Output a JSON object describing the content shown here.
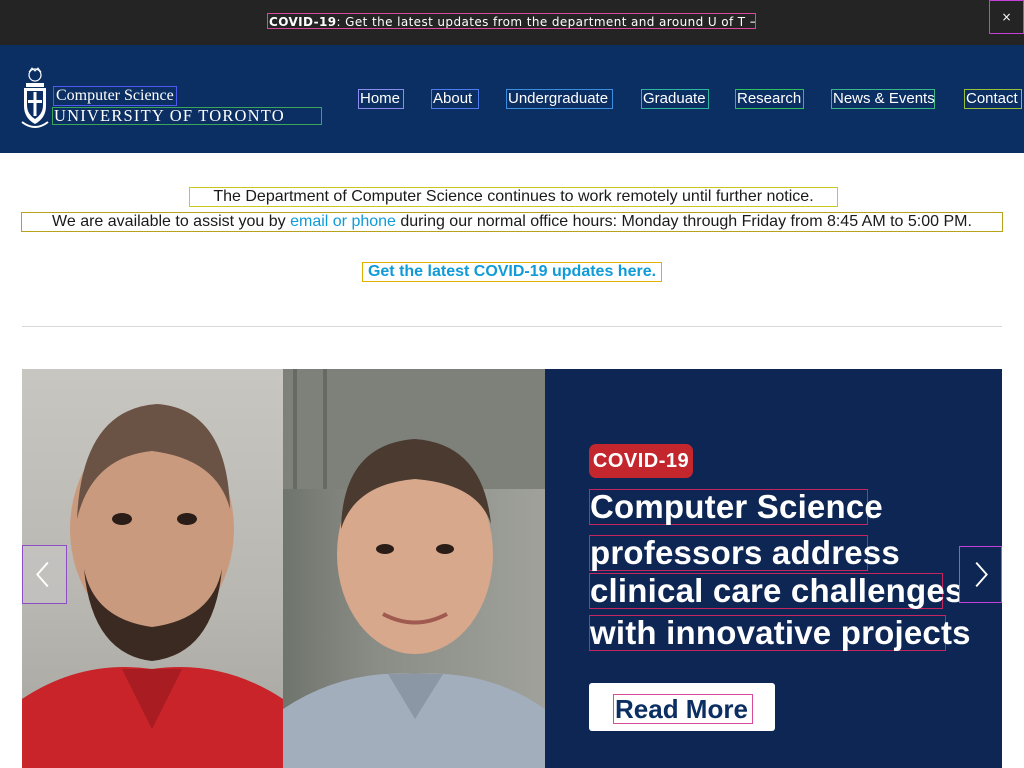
{
  "alert": {
    "label": "COVID-19",
    "text": ": Get the latest updates from the department and around U of T →",
    "close_label": "×"
  },
  "header": {
    "logo_department": "Computer Science",
    "logo_university": "UNIVERSITY OF TORONTO",
    "nav": [
      {
        "label": "Home"
      },
      {
        "label": "About"
      },
      {
        "label": "Undergraduate"
      },
      {
        "label": "Graduate"
      },
      {
        "label": "Research"
      },
      {
        "label": "News & Events"
      },
      {
        "label": "Contact"
      }
    ]
  },
  "notice": {
    "line1": "The Department of Computer Science continues to work remotely until further notice.",
    "line2_before": "We are available to assist you by ",
    "line2_link": "email or phone",
    "line2_after": " during our normal office hours: Monday through Friday from 8:45 AM to 5:00 PM.",
    "covid_link": "Get the latest COVID-19 updates here."
  },
  "carousel": {
    "badge": "COVID-19",
    "headline_lines": [
      "Computer Science",
      "professors address",
      "clinical care challenges",
      "with innovative projects"
    ],
    "cta": "Read More",
    "prev_icon": "chevron-left-icon",
    "next_icon": "chevron-right-icon"
  },
  "colors": {
    "alert_bg": "#242424",
    "header_bg": "#0c2f63",
    "slide_bg": "#0d2654",
    "badge_red": "#c4262e",
    "link": "#0f9bd7"
  }
}
